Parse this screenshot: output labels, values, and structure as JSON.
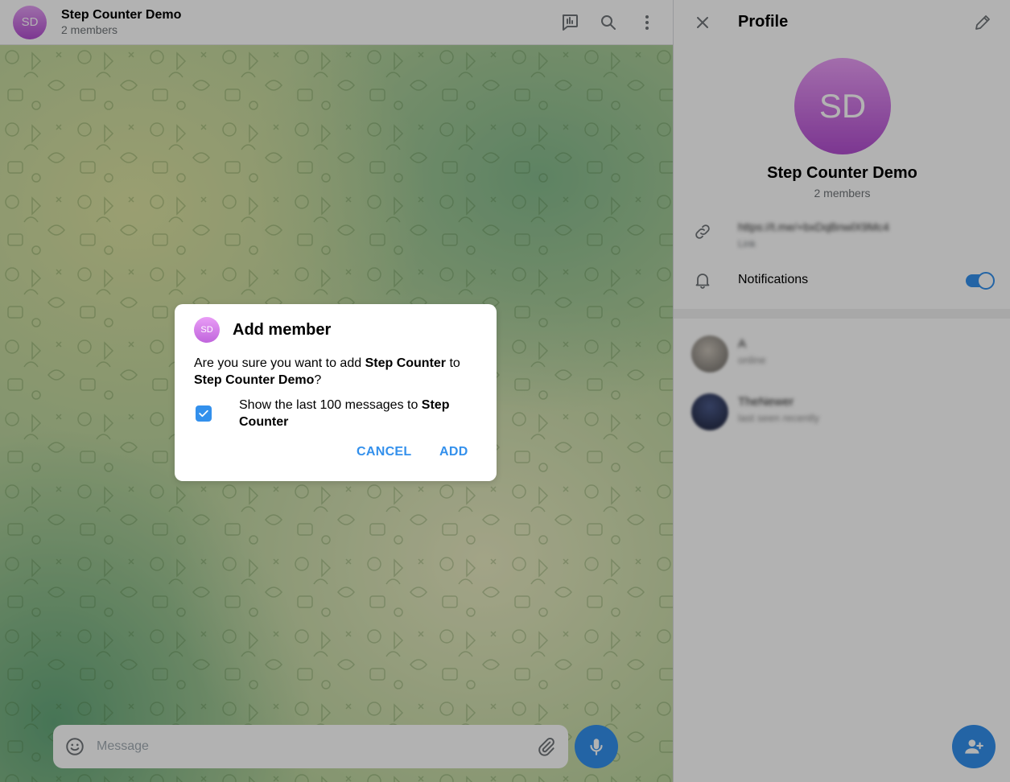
{
  "chat": {
    "avatar_initials": "SD",
    "title": "Step Counter Demo",
    "subtitle": "2 members",
    "composer_placeholder": "Message"
  },
  "profile": {
    "title": "Profile",
    "avatar_initials": "SD",
    "name": "Step Counter Demo",
    "subtitle": "2 members",
    "link": "https://t.me/+bxDqBnwlX9Mc4",
    "link_label": "Link",
    "notifications_label": "Notifications",
    "notifications_on": true,
    "members": [
      {
        "name": "A",
        "status": "online"
      },
      {
        "name": "TheNewer",
        "status": "last seen recently"
      }
    ]
  },
  "dialog": {
    "avatar_initials": "SD",
    "title": "Add member",
    "text_prefix": "Are you sure you want to add ",
    "bot_name": "Step Counter",
    "text_mid": " to ",
    "group_name": "Step Counter Demo",
    "text_suffix": "?",
    "check_prefix": "Show the last 100 messages to ",
    "check_bold": "Step Counter",
    "check_checked": true,
    "cancel_label": "CANCEL",
    "add_label": "ADD"
  },
  "colors": {
    "accent": "#3390ec",
    "avatar_gradient_top": "#e99df6",
    "avatar_gradient_bottom": "#b24ed0"
  }
}
